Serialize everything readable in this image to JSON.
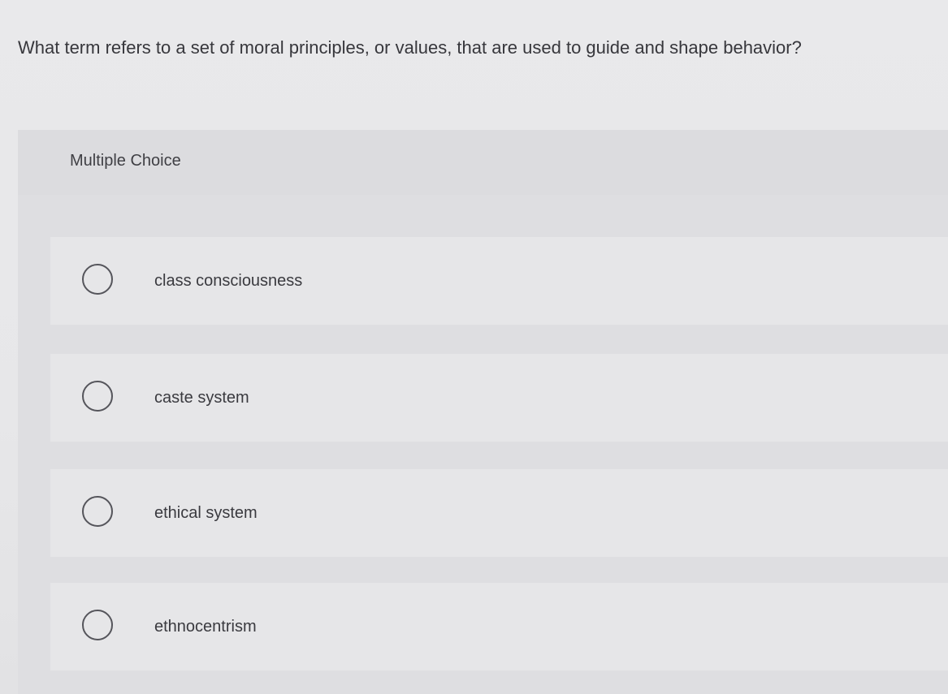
{
  "question": {
    "text": "What term refers to a set of moral principles, or values, that are used to guide and shape behavior?"
  },
  "answer_block": {
    "type_label": "Multiple Choice",
    "options": [
      {
        "label": "class consciousness",
        "selected": false
      },
      {
        "label": "caste system",
        "selected": false
      },
      {
        "label": "ethical system",
        "selected": false
      },
      {
        "label": "ethnocentrism",
        "selected": false
      }
    ]
  },
  "colors": {
    "background": "#e7e7e9",
    "header_band": "#dcdcdf",
    "option_row": "#e6e6e8",
    "text": "#3b3b40",
    "radio_border": "#55555b"
  }
}
